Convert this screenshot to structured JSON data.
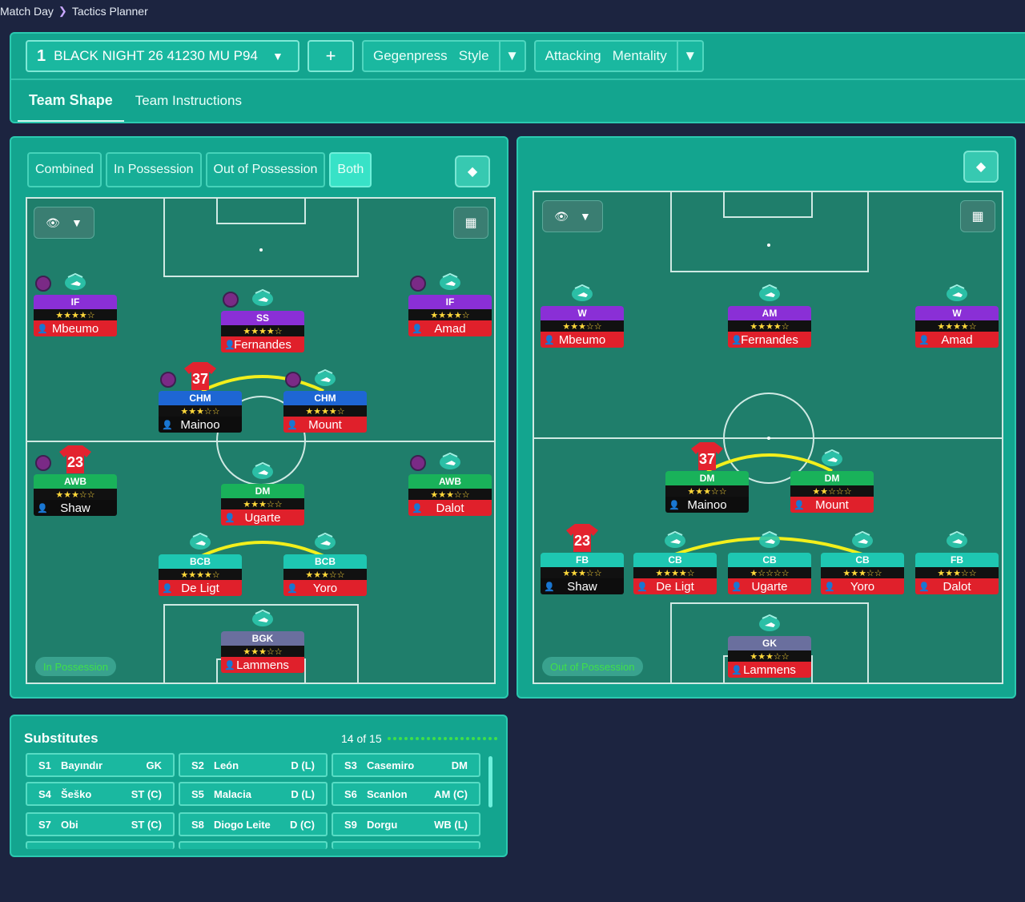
{
  "breadcrumb": {
    "first": "Match Day",
    "second": "Tactics Planner"
  },
  "toolbar": {
    "tactic_number": "1",
    "tactic_name": "BLACK NIGHT 26 41230 MU P94",
    "style_value": "Gegenpress",
    "style_label": "Style",
    "mentality_value": "Attacking",
    "mentality_label": "Mentality"
  },
  "tabs": [
    "Team Shape",
    "Team Instructions"
  ],
  "toggles": [
    "Combined",
    "In Possession",
    "Out of Possession",
    "Both"
  ],
  "left_phase": "In Possession",
  "right_phase": "Out of Possession",
  "left_players": [
    {
      "role": "IF",
      "stars": "★★★★☆",
      "name": "Mbeumo"
    },
    {
      "role": "SS",
      "stars": "★★★★☆",
      "name": "Fernandes"
    },
    {
      "role": "IF",
      "stars": "★★★★☆",
      "name": "Amad"
    },
    {
      "role": "CHM",
      "stars": "★★★☆☆",
      "name": "Mainoo",
      "shirt": "37"
    },
    {
      "role": "CHM",
      "stars": "★★★★☆",
      "name": "Mount"
    },
    {
      "role": "AWB",
      "stars": "★★★☆☆",
      "name": "Shaw",
      "shirt": "23"
    },
    {
      "role": "DM",
      "stars": "★★★☆☆",
      "name": "Ugarte"
    },
    {
      "role": "AWB",
      "stars": "★★★☆☆",
      "name": "Dalot"
    },
    {
      "role": "BCB",
      "stars": "★★★★☆",
      "name": "De Ligt"
    },
    {
      "role": "BCB",
      "stars": "★★★☆☆",
      "name": "Yoro"
    },
    {
      "role": "BGK",
      "stars": "★★★☆☆",
      "name": "Lammens"
    }
  ],
  "right_players": [
    {
      "role": "W",
      "stars": "★★★☆☆",
      "name": "Mbeumo"
    },
    {
      "role": "AM",
      "stars": "★★★★☆",
      "name": "Fernandes"
    },
    {
      "role": "W",
      "stars": "★★★★☆",
      "name": "Amad"
    },
    {
      "role": "DM",
      "stars": "★★★☆☆",
      "name": "Mainoo",
      "shirt": "37"
    },
    {
      "role": "DM",
      "stars": "★★☆☆☆",
      "name": "Mount"
    },
    {
      "role": "FB",
      "stars": "★★★☆☆",
      "name": "Shaw",
      "shirt": "23"
    },
    {
      "role": "CB",
      "stars": "★★★★☆",
      "name": "De Ligt"
    },
    {
      "role": "CB",
      "stars": "★☆☆☆☆",
      "name": "Ugarte"
    },
    {
      "role": "CB",
      "stars": "★★★☆☆",
      "name": "Yoro"
    },
    {
      "role": "FB",
      "stars": "★★★☆☆",
      "name": "Dalot"
    },
    {
      "role": "GK",
      "stars": "★★★☆☆",
      "name": "Lammens"
    }
  ],
  "substitutes": {
    "title": "Substitutes",
    "count": "14 of 15",
    "items": [
      {
        "id": "S1",
        "name": "Bayındır",
        "pos": "GK"
      },
      {
        "id": "S2",
        "name": "León",
        "pos": "D (L)"
      },
      {
        "id": "S3",
        "name": "Casemiro",
        "pos": "DM"
      },
      {
        "id": "S4",
        "name": "Šeško",
        "pos": "ST (C)"
      },
      {
        "id": "S5",
        "name": "Malacia",
        "pos": "D (L)"
      },
      {
        "id": "S6",
        "name": "Scanlon",
        "pos": "AM (C)"
      },
      {
        "id": "S7",
        "name": "Obi",
        "pos": "ST (C)"
      },
      {
        "id": "S8",
        "name": "Diogo Leite",
        "pos": "D (C)"
      },
      {
        "id": "S9",
        "name": "Dorgu",
        "pos": "WB (L)"
      }
    ]
  },
  "colors": {
    "panel": "#13a58f",
    "pitch": "#1f7e6b",
    "background": "#1c2440",
    "purple_role": "#8a2fd6",
    "blue_role": "#1e66d4",
    "green_role": "#19b25a",
    "teal_role": "#1ec7b2",
    "red_name": "#e0202b"
  }
}
